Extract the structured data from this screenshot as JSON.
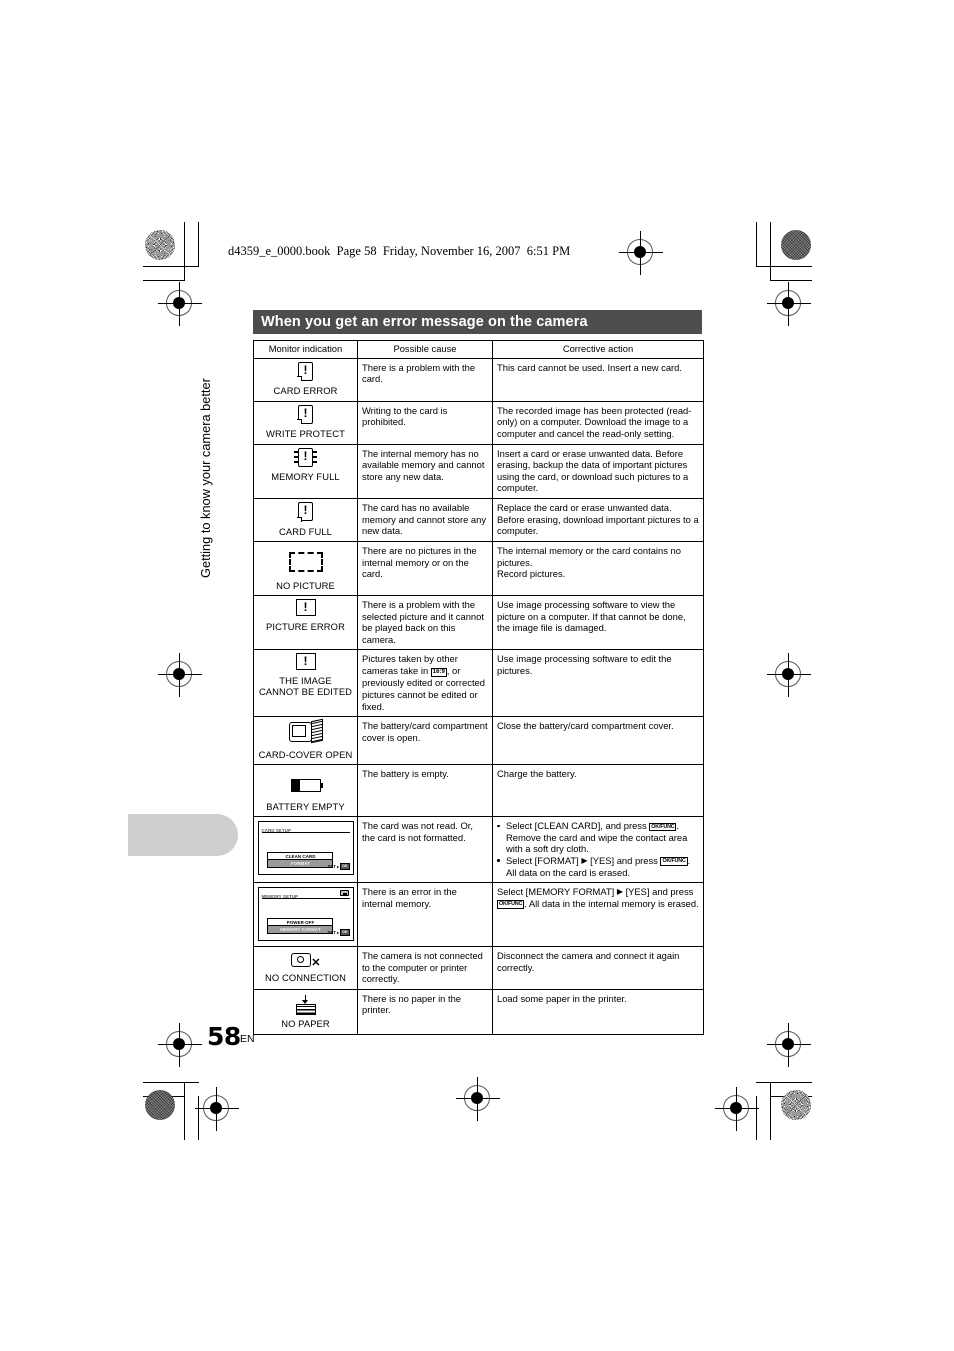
{
  "file_info": "d4359_e_0000.book  Page 58  Friday, November 16, 2007  6:51 PM",
  "section_title": "When you get an error message on the camera",
  "side_label": "Getting to know your camera better",
  "page_number": "58",
  "page_lang": "EN",
  "colors": {
    "section_bar": "#4d4d4d",
    "side_tab": "#cfcfcf",
    "menu_unselected": "#9a9a9a"
  },
  "table": {
    "headers": [
      "Monitor indication",
      "Possible cause",
      "Corrective action"
    ],
    "rows": [
      {
        "icon": "card-error-icon",
        "indication": "CARD ERROR",
        "cause": "There is a problem with the card.",
        "action": "This card cannot be used. Insert a new card."
      },
      {
        "icon": "write-protect-icon",
        "indication": "WRITE PROTECT",
        "cause": "Writing to the card is prohibited.",
        "action": "The recorded image has been protected (read-only) on a computer. Download the image to a computer and cancel the read-only setting."
      },
      {
        "icon": "memory-full-icon",
        "indication": "MEMORY FULL",
        "cause": "The internal memory has no available memory and cannot store any new data.",
        "action": "Insert a card or erase unwanted data. Before erasing, backup the data of important pictures using the card, or download such pictures to a computer."
      },
      {
        "icon": "card-full-icon",
        "indication": "CARD FULL",
        "cause": "The card has no available memory and cannot store any new data.",
        "action": "Replace the card or erase unwanted data. Before erasing, download important pictures to a computer."
      },
      {
        "icon": "no-picture-icon",
        "indication": "NO PICTURE",
        "cause": "There are no pictures in the internal memory or on the card.",
        "action_line1": "The internal memory or the card contains no pictures.",
        "action_line2": "Record pictures."
      },
      {
        "icon": "picture-error-icon",
        "indication": "PICTURE ERROR",
        "cause": "There is a problem with the selected picture and it cannot be played back on this camera.",
        "action": "Use image processing software to view the picture on a computer. If that cannot be done, the image file is damaged."
      },
      {
        "icon": "image-not-editable-icon",
        "indication": "THE IMAGE CANNOT BE EDITED",
        "cause_part1": "Pictures taken by other cameras take in ",
        "cause_badge": "16:9",
        "cause_part2": ", or previously edited or corrected pictures cannot be edited or fixed.",
        "action": "Use image processing software to edit the pictures."
      },
      {
        "icon": "card-cover-open-icon",
        "indication": "CARD-COVER OPEN",
        "cause": "The battery/card compartment cover is open.",
        "action": "Close the battery/card compartment cover."
      },
      {
        "icon": "battery-empty-icon",
        "indication": "BATTERY EMPTY",
        "cause": "The battery is empty.",
        "action": "Charge the battery."
      },
      {
        "icon": "card-setup-screen",
        "screen": {
          "title": "CARD SETUP",
          "selected_option": "CLEAN CARD",
          "other_option": "FORMAT",
          "set_label": "SET",
          "set_key": "OK"
        },
        "cause": "The card was not read. Or, the card is not formatted.",
        "action_bullets": [
          {
            "part1": "Select [CLEAN CARD], and press ",
            "key": "OK/FUNC",
            "part2": ". Remove the card and wipe the contact area with a soft dry cloth."
          },
          {
            "part1": "Select [FORMAT] ",
            "arrow": "▶",
            "part2": " [YES] and press ",
            "key": "OK/FUNC",
            "part3": ". All data on the card is erased."
          }
        ]
      },
      {
        "icon": "memory-setup-screen",
        "screen": {
          "title": "MEMORY SETUP",
          "selected_option": "POWER OFF",
          "other_option": "MEMORY FORMAT",
          "set_label": "SET",
          "set_key": "OK",
          "has_memory_icon": true
        },
        "cause": "There is an error in the internal memory.",
        "action_parts": {
          "part1": "Select [MEMORY FORMAT] ",
          "arrow": "▶",
          "part2": " [YES] and press ",
          "key": "OK/FUNC",
          "part3": ". All data in the internal memory is erased."
        }
      },
      {
        "icon": "no-connection-icon",
        "indication": "NO CONNECTION",
        "cause": "The camera is not connected to the computer or printer correctly.",
        "action": "Disconnect the camera and connect it again correctly."
      },
      {
        "icon": "no-paper-icon",
        "indication": "NO PAPER",
        "cause": "There is no paper in the printer.",
        "action": "Load some paper in the printer."
      }
    ]
  }
}
